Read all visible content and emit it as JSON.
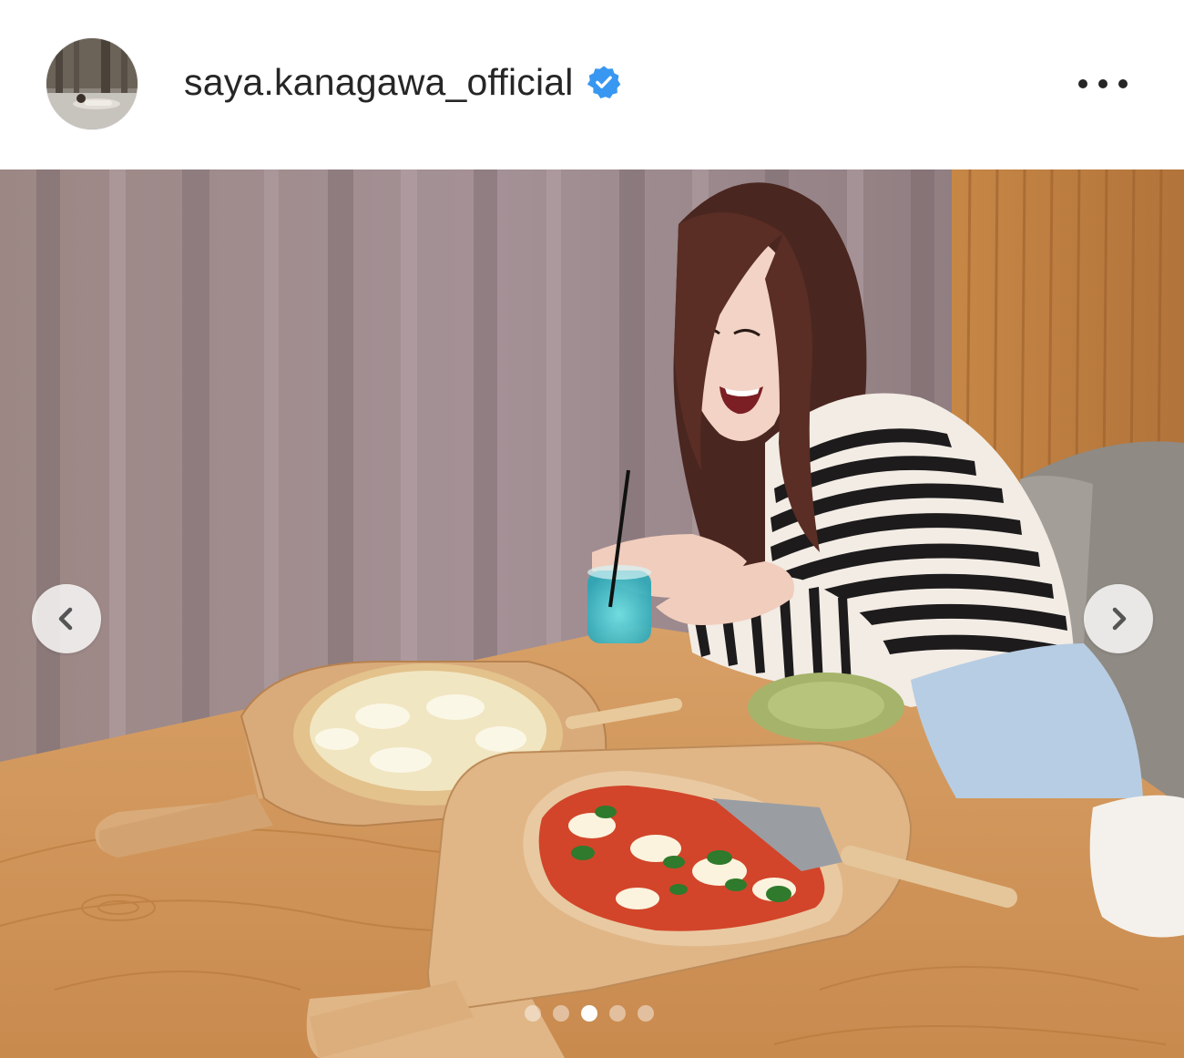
{
  "post": {
    "username": "saya.kanagawa_official",
    "verified": true,
    "avatar_icon": "profile-photo",
    "more_icon": "more-horizontal-icon",
    "colors": {
      "verified_badge": "#3897f0",
      "text": "#262626"
    }
  },
  "carousel": {
    "prev_icon": "chevron-left-icon",
    "next_icon": "chevron-right-icon",
    "total_slides": 5,
    "active_slide": 3
  }
}
